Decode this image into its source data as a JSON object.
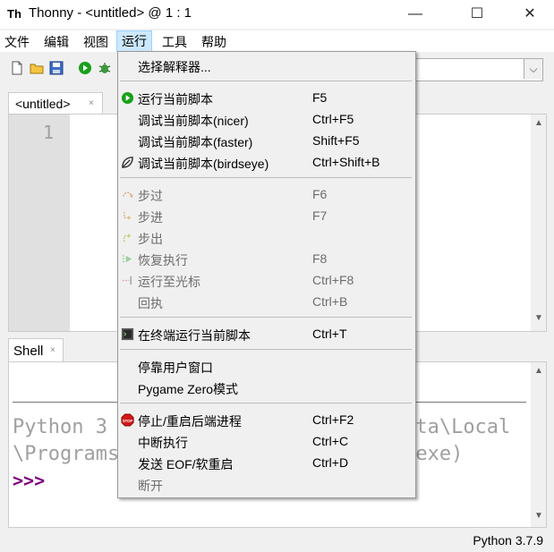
{
  "window": {
    "app_icon_text": "Th",
    "title": "Thonny  -  <untitled>  @  1 : 1",
    "minimize_glyph": "—",
    "maximize_glyph": "☐",
    "close_glyph": "✕"
  },
  "menubar": {
    "items": [
      "文件",
      "编辑",
      "视图",
      "运行",
      "工具",
      "帮助"
    ]
  },
  "toolbar": {
    "icons": [
      "new-file-icon",
      "open-folder-icon",
      "save-icon",
      "run-icon",
      "debug-icon"
    ],
    "combo_arrow": "⌵"
  },
  "editor": {
    "tab_label": "<untitled>",
    "tab_close": "×",
    "line_number": "1"
  },
  "shell": {
    "tab_label": "Shell",
    "tab_close": "×",
    "banner_line1": "Python 3                         ata\\Local",
    "banner_line2": "\\Programs                        .exe)",
    "prompt": ">>>"
  },
  "statusbar": {
    "text": "Python 3.7.9"
  },
  "run_menu": {
    "select_interpreter": "选择解释器...",
    "run_current": {
      "label": "运行当前脚本",
      "shortcut": "F5"
    },
    "debug_nicer": {
      "label": "调试当前脚本(nicer)",
      "shortcut": "Ctrl+F5"
    },
    "debug_faster": {
      "label": "调试当前脚本(faster)",
      "shortcut": "Shift+F5"
    },
    "debug_birdseye": {
      "label": "调试当前脚本(birdseye)",
      "shortcut": "Ctrl+Shift+B"
    },
    "step_over": {
      "label": "步过",
      "shortcut": "F6"
    },
    "step_into": {
      "label": "步进",
      "shortcut": "F7"
    },
    "step_out": {
      "label": "步出",
      "shortcut": ""
    },
    "resume": {
      "label": "恢复执行",
      "shortcut": "F8"
    },
    "run_to_cursor": {
      "label": "运行至光标",
      "shortcut": "Ctrl+F8"
    },
    "step_back": {
      "label": "回执",
      "shortcut": "Ctrl+B"
    },
    "run_in_terminal": {
      "label": "在终端运行当前脚本",
      "shortcut": "Ctrl+T"
    },
    "dock_user_windows": {
      "label": "停靠用户窗口",
      "shortcut": ""
    },
    "pygame_zero": {
      "label": "Pygame Zero模式",
      "shortcut": ""
    },
    "stop_restart": {
      "label": "停止/重启后端进程",
      "shortcut": "Ctrl+F2"
    },
    "interrupt": {
      "label": "中断执行",
      "shortcut": "Ctrl+C"
    },
    "send_eof": {
      "label": "发送 EOF/软重启",
      "shortcut": "Ctrl+D"
    },
    "disconnect": {
      "label": "断开",
      "shortcut": ""
    }
  },
  "colors": {
    "menu_highlight": "#cce8ff",
    "gutter": "#e0e0e0",
    "prompt": "#800080",
    "run_icon": "#1aa01a"
  }
}
